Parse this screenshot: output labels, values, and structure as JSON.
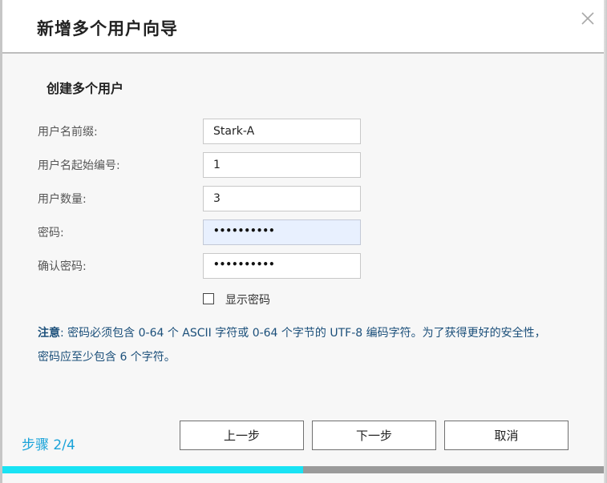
{
  "dialog": {
    "title": "新增多个用户向导",
    "section_title": "创建多个用户"
  },
  "form": {
    "prefix_label": "用户名前缀:",
    "prefix_value": "Stark-A",
    "start_label": "用户名起始编号:",
    "start_value": "1",
    "count_label": "用户数量:",
    "count_value": "3",
    "password_label": "密码:",
    "password_dots": "••••••••••",
    "confirm_label": "确认密码:",
    "confirm_dots": "••••••••••",
    "show_password_label": "显示密码"
  },
  "note": {
    "prefix": "注意",
    "text": ": 密码必须包含 0-64 个 ASCII 字符或 0-64 个字节的 UTF-8 编码字符。为了获得更好的安全性，",
    "text2": "密码应至少包含 6 个字符。"
  },
  "footer": {
    "step": "步骤 2/4",
    "prev": "上一步",
    "next": "下一步",
    "cancel": "取消",
    "progress_fraction": 0.5
  },
  "colors": {
    "accent": "#19e3f4",
    "step_text": "#1aa3d9",
    "note_text": "#1b4f7a"
  },
  "icons": {
    "close": "close-icon"
  }
}
